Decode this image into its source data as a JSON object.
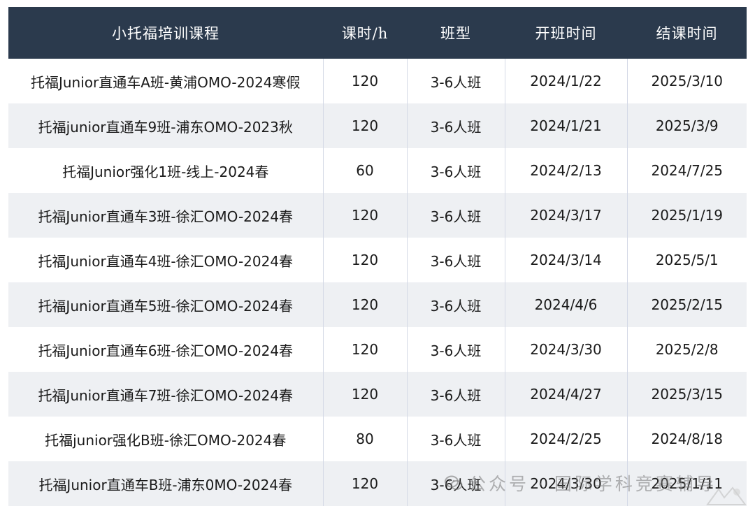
{
  "table": {
    "headers": [
      "小托福培训课程",
      "课时/h",
      "班型",
      "开班时间",
      "结课时间"
    ],
    "rows": [
      [
        "托福Junior直通车A班-黄浦OMO-2024寒假",
        "120",
        "3-6人班",
        "2024/1/22",
        "2025/3/10"
      ],
      [
        "托福junior直通车9班-浦东OMO-2023秋",
        "120",
        "3-6人班",
        "2024/1/21",
        "2025/3/9"
      ],
      [
        "托福Junior强化1班-线上-2024春",
        "60",
        "3-6人班",
        "2024/2/13",
        "2024/7/25"
      ],
      [
        "托福Junior直通车3班-徐汇OMO-2024春",
        "120",
        "3-6人班",
        "2024/3/17",
        "2025/1/19"
      ],
      [
        "托福Junior直通车4班-徐汇OMO-2024春",
        "120",
        "3-6人班",
        "2024/3/14",
        "2025/5/1"
      ],
      [
        "托福Junior直通车5班-徐汇OMO-2024春",
        "120",
        "3-6人班",
        "2024/4/6",
        "2025/2/15"
      ],
      [
        "托福Junior直通车6班-徐汇OMO-2024春",
        "120",
        "3-6人班",
        "2024/3/30",
        "2025/2/8"
      ],
      [
        "托福Junior直通车7班-徐汇OMO-2024春",
        "120",
        "3-6人班",
        "2024/4/27",
        "2025/3/15"
      ],
      [
        "托福junior强化B班-徐汇OMO-2024春",
        "80",
        "3-6人班",
        "2024/2/25",
        "2024/8/18"
      ],
      [
        "托福Junior直通车B班-浦东0MO-2024春",
        "120",
        "3-6人班",
        "2024/3/30",
        "2025/1/11"
      ]
    ]
  },
  "watermark": {
    "text": "公众号 · 国际学科竞赛辅导",
    "icon": "wechat-icon"
  },
  "colors": {
    "header_bg": "#2b3a4d",
    "header_text": "#ffffff",
    "row_alt_bg": "#eef0f3",
    "cell_border": "#d4d9e6"
  }
}
